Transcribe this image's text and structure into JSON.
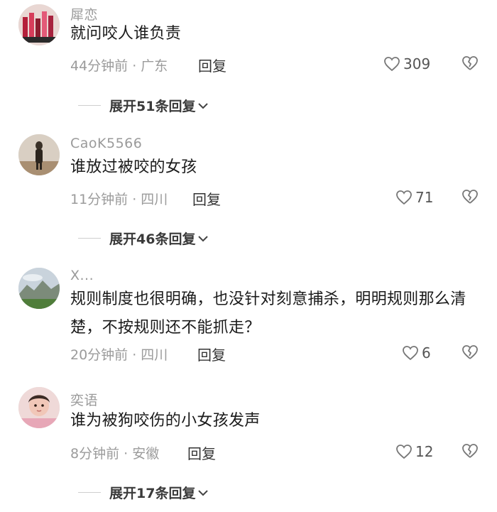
{
  "comments": [
    {
      "username": "犀恋",
      "text": "就问咬人谁负责",
      "meta": "44分钟前 · 广东",
      "reply_label": "回复",
      "likes": "309",
      "expand_label": "展开51条回复"
    },
    {
      "username": "CaoK5566",
      "text": "谁放过被咬的女孩",
      "meta": "11分钟前 · 四川",
      "reply_label": "回复",
      "likes": "71",
      "expand_label": "展开46条回复"
    },
    {
      "username": "X...",
      "text": "规则制度也很明确，也没针对刻意捕杀，明明规则那么清楚，不按规则还不能抓走？",
      "meta": "20分钟前 · 四川",
      "reply_label": "回复",
      "likes": "6"
    },
    {
      "username": "奕语",
      "text": "谁为被狗咬伤的小女孩发声",
      "meta": "8分钟前 · 安徽",
      "reply_label": "回复",
      "likes": "12",
      "expand_label": "展开17条回复"
    }
  ]
}
